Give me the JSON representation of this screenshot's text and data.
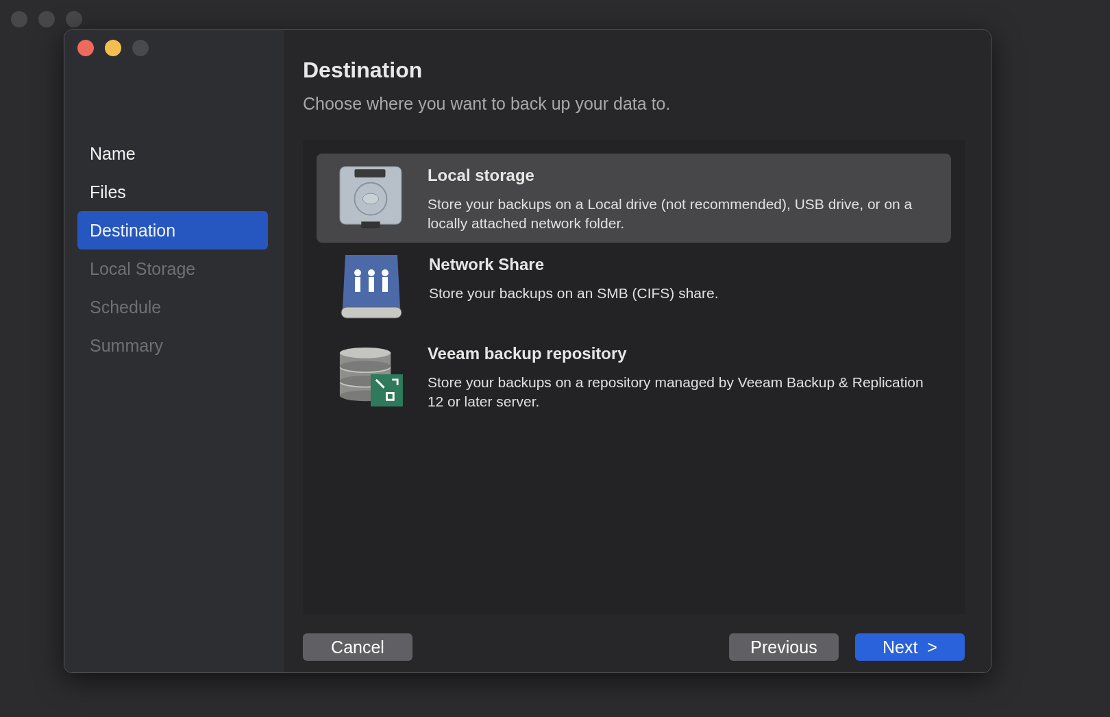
{
  "dialog": {
    "title": "Destination",
    "subtitle": "Choose where you want to back up your data to."
  },
  "steps": [
    {
      "label": "Name",
      "selected": false,
      "disabled": false
    },
    {
      "label": "Files",
      "selected": false,
      "disabled": false
    },
    {
      "label": "Destination",
      "selected": true,
      "disabled": false
    },
    {
      "label": "Local Storage",
      "selected": false,
      "disabled": true
    },
    {
      "label": "Schedule",
      "selected": false,
      "disabled": true
    },
    {
      "label": "Summary",
      "selected": false,
      "disabled": true
    }
  ],
  "options": [
    {
      "kind": "disk",
      "title": "Local storage",
      "description": "Store your backups on a Local drive (not recommended), USB drive, or on a locally attached network folder.",
      "selected": true
    },
    {
      "kind": "network",
      "title": "Network Share",
      "description": "Store your backups on an SMB (CIFS) share.",
      "selected": false
    },
    {
      "kind": "repository",
      "title": "Veeam backup repository",
      "description": "Store your backups on a repository managed by Veeam Backup & Replication 12 or later server.",
      "selected": false
    }
  ],
  "buttons": [
    {
      "kind": "cancel",
      "label": "Cancel"
    },
    {
      "kind": "previous",
      "label": "Previous"
    },
    {
      "kind": "next",
      "label": "Next  >"
    }
  ]
}
